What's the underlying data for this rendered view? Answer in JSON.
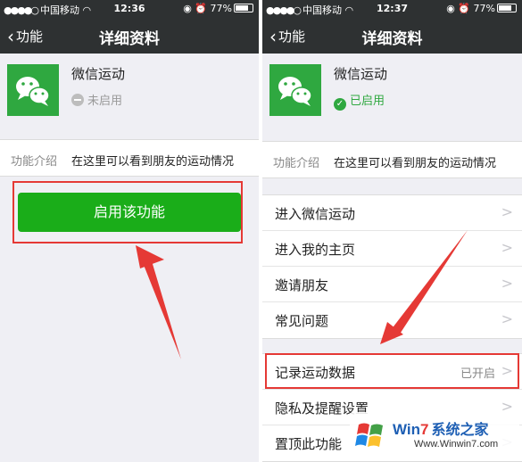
{
  "left": {
    "status_bar": {
      "carrier": "中国移动",
      "time": "12:36",
      "battery": "77%"
    },
    "nav": {
      "back_label": "功能",
      "title": "详细资料"
    },
    "app": {
      "name": "微信运动",
      "status": "未启用"
    },
    "intro": {
      "label": "功能介绍",
      "text": "在这里可以看到朋友的运动情况"
    },
    "enable_button": "启用该功能"
  },
  "right": {
    "status_bar": {
      "carrier": "中国移动",
      "time": "12:37",
      "battery": "77%"
    },
    "nav": {
      "back_label": "功能",
      "title": "详细资料"
    },
    "app": {
      "name": "微信运动",
      "status": "已启用"
    },
    "intro": {
      "label": "功能介绍",
      "text": "在这里可以看到朋友的运动情况"
    },
    "menu_group_1": [
      {
        "label": "进入微信运动"
      },
      {
        "label": "进入我的主页"
      },
      {
        "label": "邀请朋友"
      },
      {
        "label": "常见问题"
      }
    ],
    "menu_group_2": [
      {
        "label": "记录运动数据",
        "value": "已开启"
      },
      {
        "label": "隐私及提醒设置"
      },
      {
        "label": "置顶此功能"
      }
    ]
  },
  "watermark": {
    "brand_win": "Win",
    "brand_seven": "7",
    "brand_cn": "系统之家",
    "url": "Www.Winwin7.com"
  },
  "colors": {
    "nav_bg": "#2e3132",
    "wechat_green": "#2fa840",
    "button_green": "#1aad19",
    "highlight_red": "#e53935"
  },
  "battery_level": 0.77
}
